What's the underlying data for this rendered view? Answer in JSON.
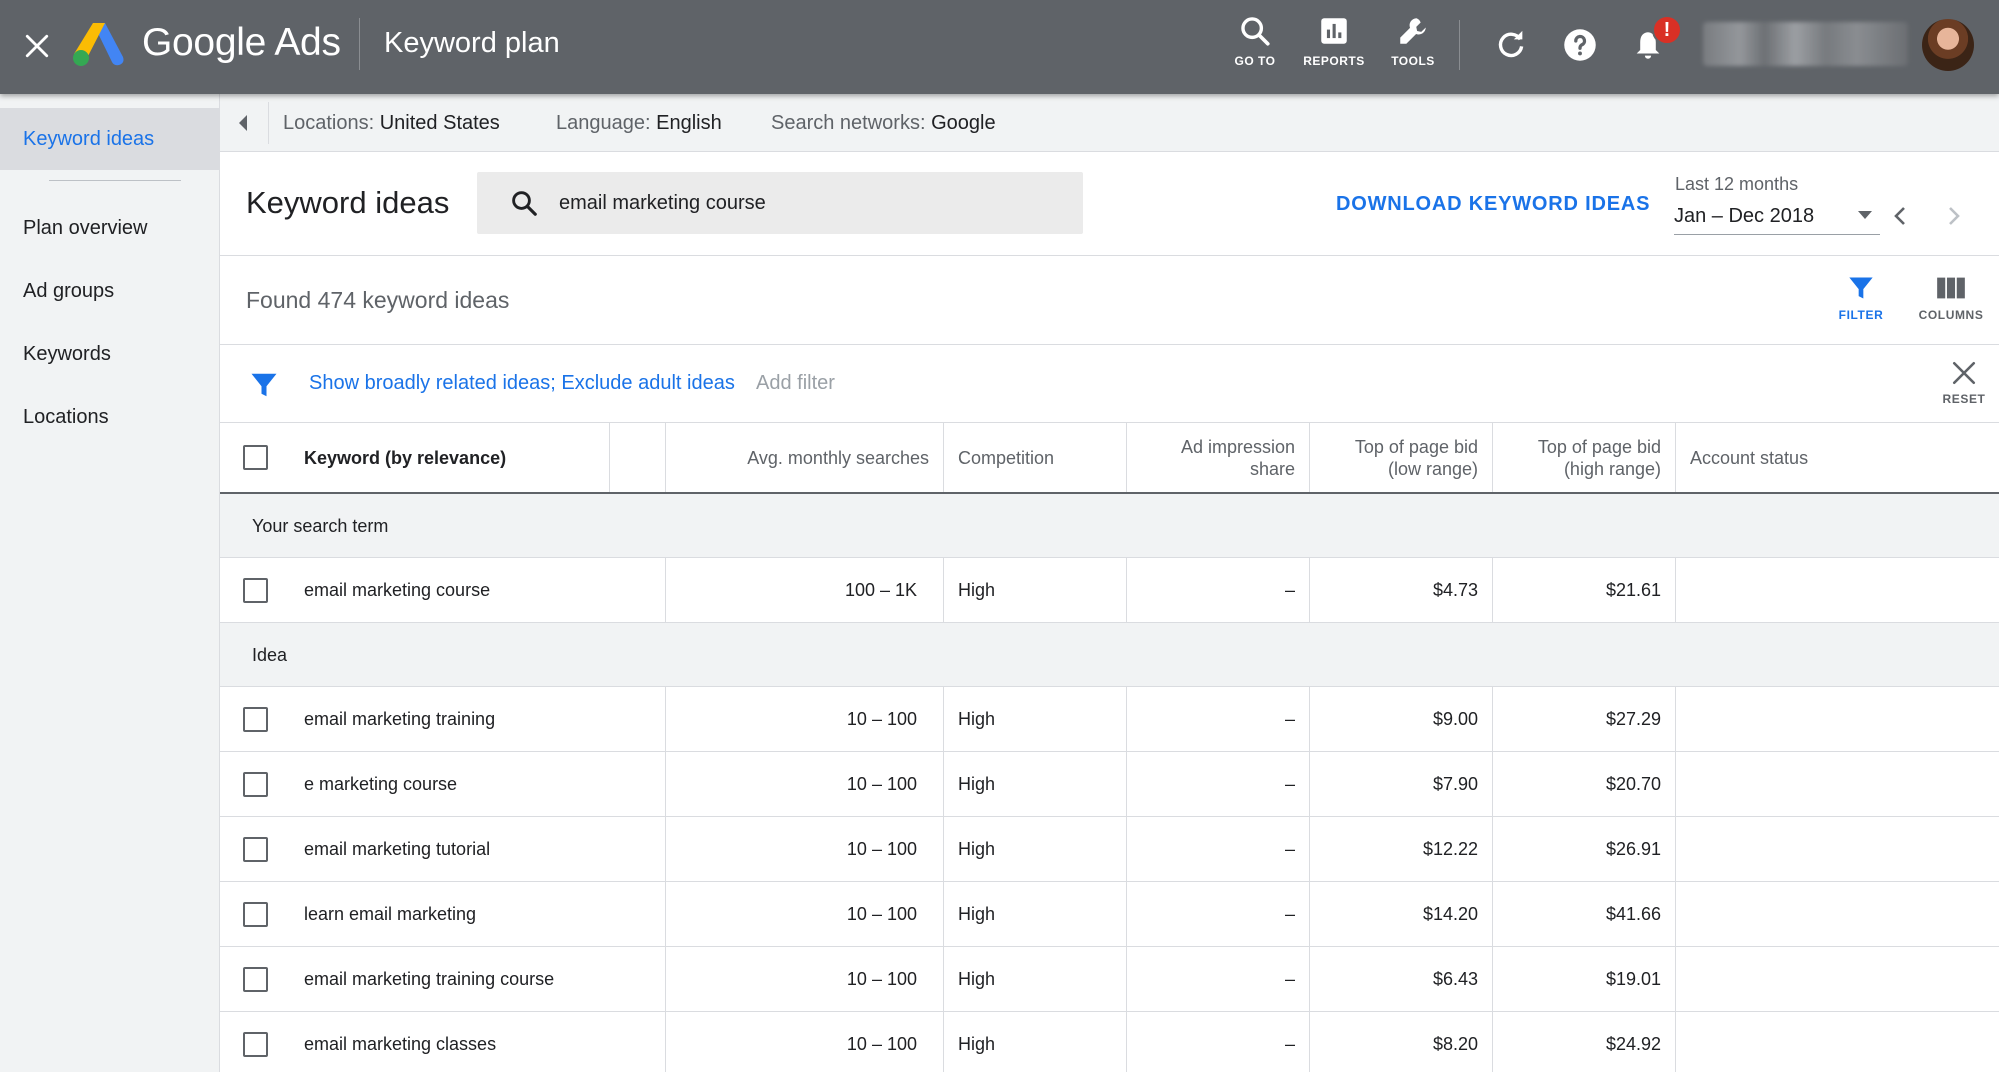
{
  "topbar": {
    "brand": "Google Ads",
    "page_title": "Keyword plan",
    "nav": [
      {
        "label": "GO TO",
        "icon": "search-icon"
      },
      {
        "label": "REPORTS",
        "icon": "reports-icon"
      },
      {
        "label": "TOOLS",
        "icon": "wrench-icon"
      }
    ],
    "notification_badge": "!"
  },
  "sidebar": {
    "items": [
      {
        "label": "Keyword ideas",
        "active": true
      },
      {
        "label": "Plan overview"
      },
      {
        "label": "Ad groups"
      },
      {
        "label": "Keywords"
      },
      {
        "label": "Locations"
      }
    ]
  },
  "filters_bar": {
    "locations_label": "Locations:",
    "locations_value": "United States",
    "language_label": "Language:",
    "language_value": "English",
    "networks_label": "Search networks:",
    "networks_value": "Google"
  },
  "header": {
    "title": "Keyword ideas",
    "search_value": "email marketing course",
    "download_label": "DOWNLOAD KEYWORD IDEAS",
    "date_range_label": "Last 12 months",
    "date_range_value": "Jan – Dec 2018"
  },
  "results": {
    "found_text": "Found 474 keyword ideas",
    "filter_label": "FILTER",
    "columns_label": "COLUMNS",
    "active_filters": "Show broadly related ideas; Exclude adult ideas",
    "add_filter": "Add filter",
    "reset_label": "RESET"
  },
  "table": {
    "columns": {
      "keyword": "Keyword (by relevance)",
      "avg": "Avg. monthly searches",
      "competition": "Competition",
      "impression_1": "Ad impression",
      "impression_2": "share",
      "low_1": "Top of page bid",
      "low_2": "(low range)",
      "high_1": "Top of page bid",
      "high_2": "(high range)",
      "status": "Account status"
    },
    "search_term_group": "Your search term",
    "search_term_row": {
      "keyword": "email marketing course",
      "avg": "100 – 1K",
      "competition": "High",
      "impression": "–",
      "low": "$4.73",
      "high": "$21.61",
      "status": ""
    },
    "idea_group": "Idea",
    "ideas": [
      {
        "keyword": "email marketing training",
        "avg": "10 – 100",
        "competition": "High",
        "impression": "–",
        "low": "$9.00",
        "high": "$27.29",
        "status": ""
      },
      {
        "keyword": "e marketing course",
        "avg": "10 – 100",
        "competition": "High",
        "impression": "–",
        "low": "$7.90",
        "high": "$20.70",
        "status": ""
      },
      {
        "keyword": "email marketing tutorial",
        "avg": "10 – 100",
        "competition": "High",
        "impression": "–",
        "low": "$12.22",
        "high": "$26.91",
        "status": ""
      },
      {
        "keyword": "learn email marketing",
        "avg": "10 – 100",
        "competition": "High",
        "impression": "–",
        "low": "$14.20",
        "high": "$41.66",
        "status": ""
      },
      {
        "keyword": "email marketing training course",
        "avg": "10 – 100",
        "competition": "High",
        "impression": "–",
        "low": "$6.43",
        "high": "$19.01",
        "status": ""
      },
      {
        "keyword": "email marketing classes",
        "avg": "10 – 100",
        "competition": "High",
        "impression": "–",
        "low": "$8.20",
        "high": "$24.92",
        "status": ""
      }
    ]
  },
  "colors": {
    "topbar": "#5f6368",
    "accent_blue": "#1a73e8",
    "alert_red": "#d93025",
    "sidebar_bg": "#f1f3f4"
  }
}
